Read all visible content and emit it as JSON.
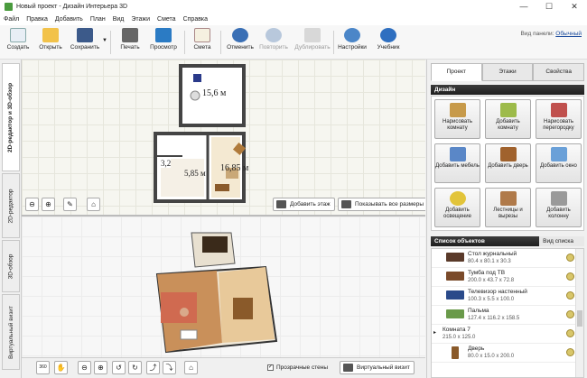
{
  "window": {
    "title": "Новый проект - Дизайн Интерьера 3D",
    "min": "—",
    "max": "☐",
    "close": "✕"
  },
  "menu": [
    "Файл",
    "Правка",
    "Добавить",
    "План",
    "Вид",
    "Этажи",
    "Смета",
    "Справка"
  ],
  "toolbar": {
    "create": "Создать",
    "open": "Открыть",
    "save": "Сохранить",
    "print": "Печать",
    "preview": "Просмотр",
    "estimate": "Смета",
    "undo": "Отменить",
    "redo": "Повторить",
    "duplicate": "Дублировать",
    "settings": "Настройки",
    "tutorial": "Учебник",
    "panel_view_label": "Вид панели:",
    "panel_view_value": "Обычный"
  },
  "left_tabs": [
    "2D-редактор и 3D-обзор",
    "2D-редактор",
    "3D-обзор",
    "Виртуальный визит"
  ],
  "plan": {
    "rooms": [
      "15,6 м",
      "3,2",
      "5,85 м",
      "16,85 м"
    ],
    "add_floor": "Добавить этаж",
    "show_sizes": "Показывать все размеры"
  },
  "view3d": {
    "transparent_walls": "Прозрачные стены",
    "virtual_visit": "Виртуальный визит",
    "rotate_label": "360"
  },
  "right_tabs": [
    "Проект",
    "Этажи",
    "Свойства"
  ],
  "design": {
    "title": "Дизайн",
    "buttons": [
      {
        "label": "Нарисовать комнату",
        "color": "#c79a4a"
      },
      {
        "label": "Добавить комнату",
        "color": "#9dbb4a"
      },
      {
        "label": "Нарисовать перегородку",
        "color": "#c0504d"
      },
      {
        "label": "Добавить мебель",
        "color": "#5a87c7"
      },
      {
        "label": "Добавить дверь",
        "color": "#a0622d"
      },
      {
        "label": "Добавить окно",
        "color": "#6aa0d8"
      },
      {
        "label": "Добавить освещение",
        "color": "#e2c43a"
      },
      {
        "label": "Лестницы и вырезы",
        "color": "#b07a4a"
      },
      {
        "label": "Добавить колонну",
        "color": "#9a9a9a"
      }
    ]
  },
  "objects": {
    "title": "Список объектов",
    "view_link": "Вид списка",
    "items": [
      {
        "name": "Стол журнальный",
        "dims": "80.4 x 80.1 x 30.3"
      },
      {
        "name": "Тумба под ТВ",
        "dims": "200.0 x 43.7 x 72.8"
      },
      {
        "name": "Телевизор настенный",
        "dims": "100.3 x 5.5 x 100.0"
      },
      {
        "name": "Пальма",
        "dims": "127.4 x 116.2 x 158.5"
      },
      {
        "name": "Комната 7",
        "dims": "215.0 x 125.0"
      },
      {
        "name": "Дверь",
        "dims": "80.0 x 15.0 x 200.0"
      }
    ]
  }
}
